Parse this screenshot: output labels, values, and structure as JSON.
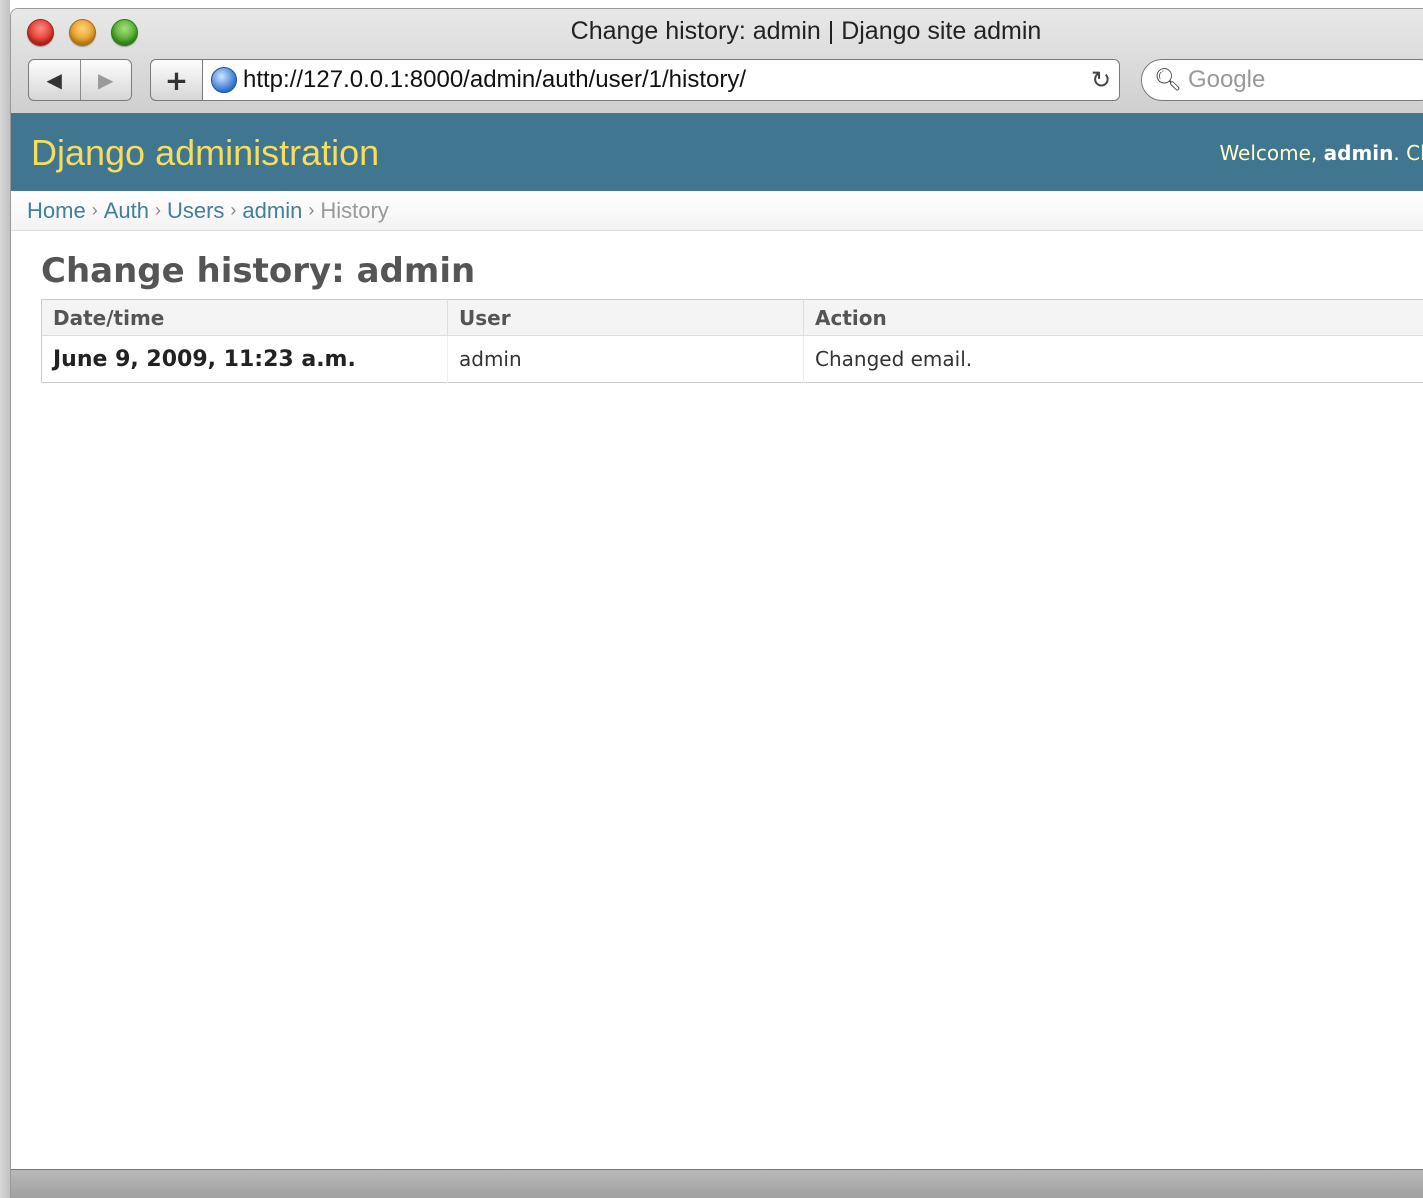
{
  "window": {
    "title": "Change history: admin | Django site admin"
  },
  "toolbar": {
    "back_label": "◀",
    "forward_label": "▶",
    "add_label": "+",
    "url": "http://127.0.0.1:8000/admin/auth/user/1/history/",
    "search_placeholder": "Google"
  },
  "site": {
    "branding": "Django administration",
    "welcome": "Welcome, ",
    "user": "admin",
    "change_password": ". Change password"
  },
  "breadcrumbs": [
    {
      "label": "Home"
    },
    {
      "label": "Auth"
    },
    {
      "label": "Users"
    },
    {
      "label": "admin"
    },
    {
      "label": "History"
    }
  ],
  "page": {
    "title": "Change history: admin"
  },
  "history_table": {
    "headers": [
      "Date/time",
      "User",
      "Action"
    ],
    "rows": [
      {
        "datetime": "June 9, 2009, 11:23 a.m.",
        "user": "admin",
        "action": "Changed email."
      }
    ]
  }
}
